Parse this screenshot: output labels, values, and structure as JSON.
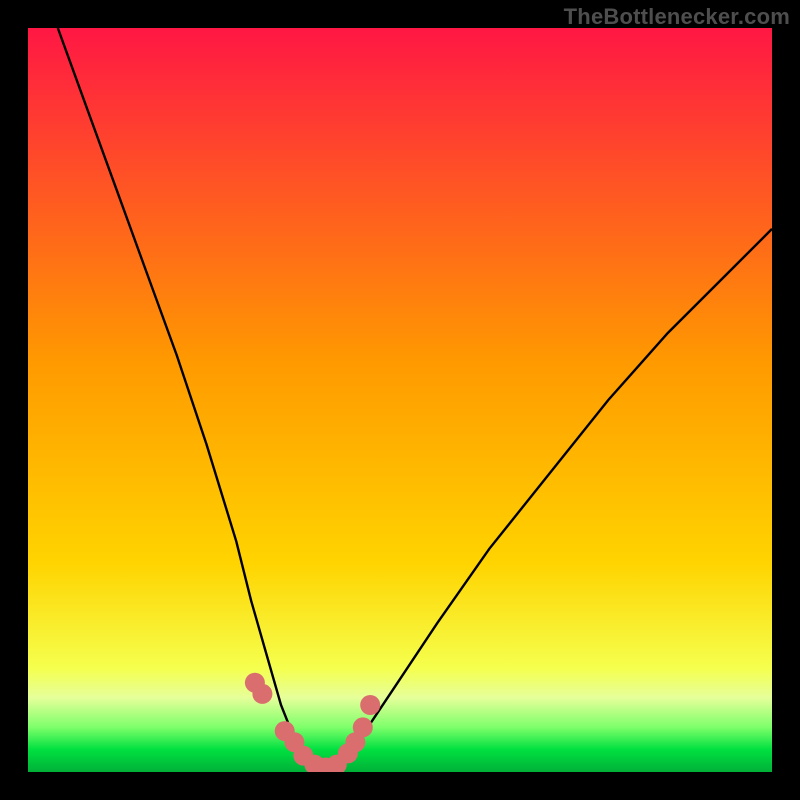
{
  "watermark": "TheBottlenecker.com",
  "colors": {
    "bg": "#000000",
    "curve": "#000000",
    "marker": "#da6e6e",
    "gradient_top": "#ff1744",
    "gradient_mid": "#ffd400",
    "gradient_green_light": "#e6ff9a",
    "gradient_green": "#00e040",
    "gradient_green_dark": "#00b038"
  },
  "chart_data": {
    "type": "line",
    "title": "",
    "xlabel": "",
    "ylabel": "",
    "xlim": [
      0,
      100
    ],
    "ylim": [
      0,
      100
    ],
    "note": "x-axis ~ component balance position (CPU-bound left to GPU-bound right); y-axis ~ bottleneck severity 0-100; green band = low bottleneck region",
    "series": [
      {
        "name": "bottleneck-curve",
        "x": [
          4,
          8,
          12,
          16,
          20,
          24,
          28,
          30,
          32,
          34,
          36,
          37,
          38,
          39,
          40,
          41,
          42,
          45,
          49,
          55,
          62,
          70,
          78,
          86,
          94,
          100
        ],
        "y": [
          100,
          89,
          78,
          67,
          56,
          44,
          31,
          23,
          16,
          9,
          4,
          2,
          0.5,
          0,
          0,
          0.5,
          2,
          5,
          11,
          20,
          30,
          40,
          50,
          59,
          67,
          73
        ]
      }
    ],
    "markers": {
      "name": "highlighted-points",
      "x": [
        30.5,
        31.5,
        34.5,
        35.8,
        37,
        38.5,
        40,
        41.5,
        43,
        44,
        45,
        46
      ],
      "y": [
        12,
        10.5,
        5.5,
        4,
        2.2,
        1,
        0.6,
        1,
        2.5,
        4,
        6,
        9
      ]
    },
    "green_band": {
      "y_from": 0,
      "y_to": 14
    }
  }
}
